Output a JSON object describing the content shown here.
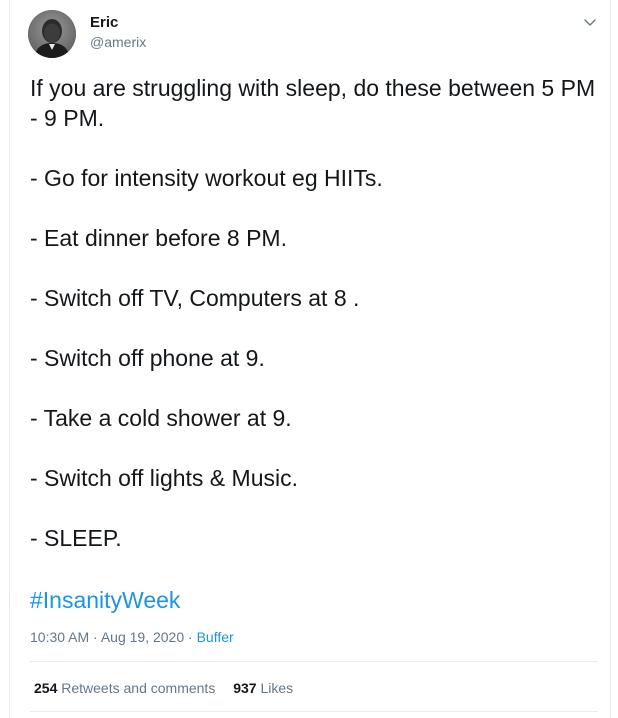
{
  "author": {
    "name": "Eric",
    "handle": "@amerix"
  },
  "tweet": {
    "lines": [
      "If you are struggling with sleep, do these between 5 PM - 9 PM.",
      "- Go for intensity workout eg HIITs.",
      "- Eat dinner before 8 PM.",
      "- Switch off TV, Computers at 8 .",
      "- Switch off phone at 9.",
      "- Take a cold shower at 9.",
      "- Switch off lights & Music.",
      "- SLEEP."
    ],
    "hashtag": "#InsanityWeek"
  },
  "meta": {
    "time": "10:30 AM",
    "separator1": " · ",
    "date": "Aug 19, 2020",
    "separator2": " · ",
    "source": "Buffer"
  },
  "stats": {
    "retweets_count": "254",
    "retweets_label": "Retweets and comments",
    "likes_count": "937",
    "likes_label": "Likes"
  },
  "icons": {
    "caret": "chevron-down-icon",
    "avatar": "avatar"
  },
  "colors": {
    "link": "#1b95e0",
    "text": "#14171a",
    "muted": "#657786",
    "border": "#e6ecf0"
  }
}
